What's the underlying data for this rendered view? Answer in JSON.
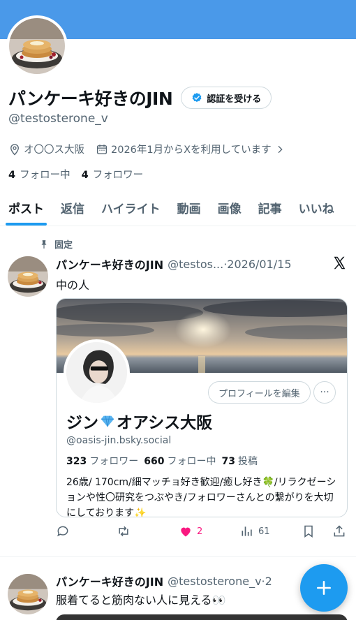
{
  "profile": {
    "display_name": "パンケーキ好きのJIN",
    "handle": "@testosterone_v",
    "verify_label": "認証を受ける",
    "location": "オ〇〇ス大阪",
    "joined": "2026年1月からXを利用しています",
    "following_count": "4",
    "following_label": "フォロー中",
    "followers_count": "4",
    "followers_label": "フォロワー"
  },
  "tabs": [
    {
      "label": "ポスト"
    },
    {
      "label": "返信"
    },
    {
      "label": "ハイライト"
    },
    {
      "label": "動画"
    },
    {
      "label": "画像"
    },
    {
      "label": "記事"
    },
    {
      "label": "いいね"
    }
  ],
  "pinned_post": {
    "pinned_label": "固定",
    "name": "パンケーキ好きのJIN",
    "meta": "@testos...·2026/01/15",
    "text": "中の人",
    "card": {
      "edit_label": "プロフィールを編集",
      "more_label": "···",
      "name_part1": "ジン",
      "name_part2": "オアシス大阪",
      "handle": "@oasis-jin.bsky.social",
      "followers_count": "323",
      "followers_label": "フォロワー",
      "following_count": "660",
      "following_label": "フォロー中",
      "posts_count": "73",
      "posts_label": "投稿",
      "bio": "26歳/ 170cm/細マッチョ好き歓迎/癒し好き🍀/リラクゼーションや性〇研究をつぶやき/フォロワーさんとの繋がりを大切にしております✨"
    },
    "likes": "2",
    "views": "61"
  },
  "second_post": {
    "name": "パンケーキ好きのJIN",
    "meta": "@testosterone_v·2",
    "text": "服着てると筋肉ない人に見える👀"
  },
  "colors": {
    "banner": "#4a99e9",
    "accent": "#1d9bf0",
    "like": "#f91880"
  }
}
